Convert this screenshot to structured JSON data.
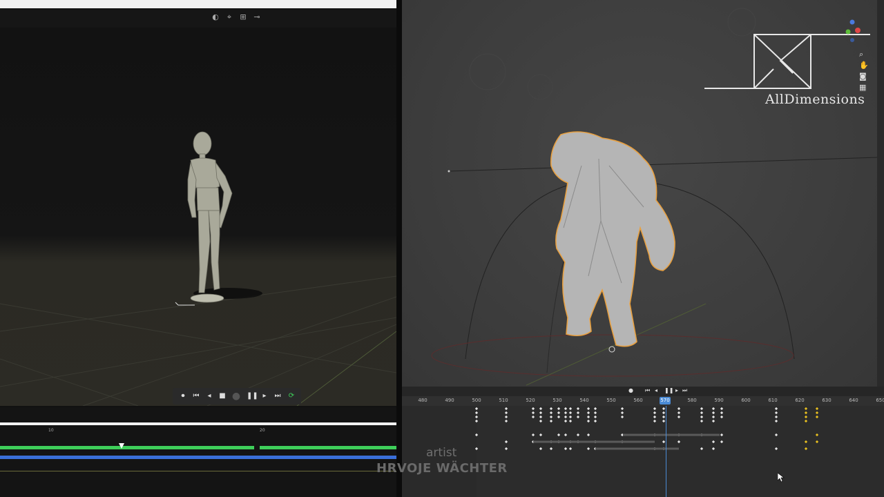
{
  "left": {
    "toolbar": {
      "icons": [
        "frame-icon",
        "snap-icon",
        "transform-icon",
        "pin-icon"
      ]
    },
    "playback": {
      "icons": [
        "record-icon",
        "skip-start-icon",
        "step-back-icon",
        "stop-icon",
        "scrub-dot-icon",
        "pause-icon",
        "step-forward-icon",
        "skip-end-icon",
        "loop-icon"
      ]
    },
    "timeline": {
      "ticks": [
        "10",
        "20"
      ]
    }
  },
  "right": {
    "logo": {
      "text": "AllDimensions"
    },
    "dopesheet": {
      "ticks": [
        "480",
        "490",
        "500",
        "510",
        "520",
        "530",
        "540",
        "550",
        "560",
        "570",
        "580",
        "590",
        "600",
        "610",
        "620",
        "630",
        "640",
        "650"
      ],
      "current_frame": "570"
    }
  },
  "watermark": {
    "artist_label": "artist",
    "artist_name": "HRVOJE WÄCHTER"
  },
  "colors": {
    "accent_blue": "#4a8bd6",
    "selection_orange": "#e8a040",
    "track_green": "#3ecf5a",
    "track_blue": "#3a6fd8",
    "key_yellow": "#e8c020"
  }
}
